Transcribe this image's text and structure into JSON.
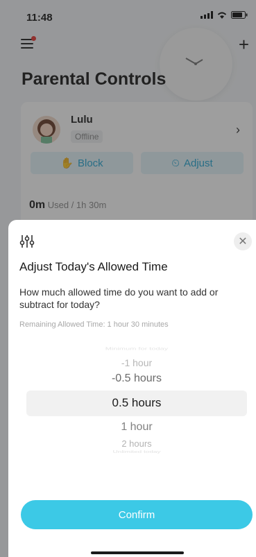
{
  "status_bar": {
    "time": "11:48"
  },
  "background_page": {
    "title": "Parental Controls",
    "child": {
      "name": "Lulu",
      "status": "Offline",
      "block_label": "Block",
      "adjust_label": "Adjust",
      "used_time": "0m",
      "used_of": "Used / 1h 30m"
    }
  },
  "sheet": {
    "title": "Adjust Today's Allowed Time",
    "question": "How much allowed time do you want to add or subtract for today?",
    "remaining": "Remaining Allowed Time: 1 hour 30 minutes",
    "picker": {
      "options": [
        "Minimum for today",
        "-1 hour",
        "-0.5 hours",
        "0.5 hours",
        "1 hour",
        "2 hours",
        "Unlimited today"
      ],
      "selected": "0.5 hours"
    },
    "confirm_label": "Confirm"
  },
  "colors": {
    "accent": "#3cc9e6",
    "accent_text": "#2aa8d4",
    "notification_dot": "#e53935"
  }
}
